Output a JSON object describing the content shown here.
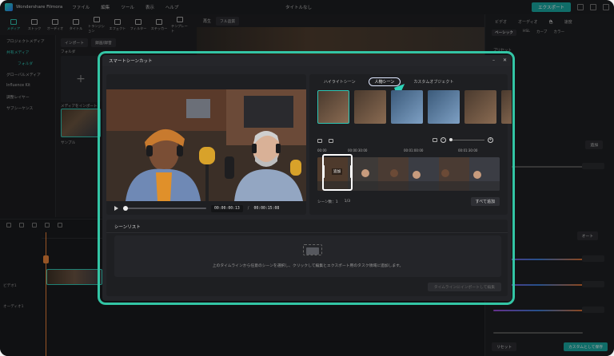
{
  "app": {
    "name": "Wondershare Filmora",
    "doc_title": "タイトルなし",
    "menu": [
      "ファイル",
      "編集",
      "ツール",
      "表示",
      "ヘルプ"
    ],
    "export_label": "エクスポート"
  },
  "toolbar": {
    "tools": [
      "メディア",
      "ストック",
      "オーディオ",
      "タイトル",
      "トランジション",
      "エフェクト",
      "フィルター",
      "ステッカー",
      "テンプレート"
    ]
  },
  "sidebar": {
    "items": [
      "プロジェクトメディア",
      "共有メディア",
      "フォルダ",
      "グローバルメディア",
      "Influence Kit",
      "調整レイヤー",
      "サブシーケンス"
    ]
  },
  "media": {
    "import_label": "インポート",
    "filter_label": "録画/録音",
    "folder_label": "フォルダ",
    "import_tile_label": "メディアをインポート",
    "sample_label": "サンプル"
  },
  "preview": {
    "quality_label": "再生",
    "quality_value": "フル品質"
  },
  "inspector": {
    "tabs": [
      "ビデオ",
      "オーディオ",
      "色",
      "速度"
    ],
    "subtabs": [
      "ベーシック",
      "HSL",
      "カーブ",
      "カラー"
    ],
    "preset_label": "プリセット",
    "add_label": "追加",
    "auto_label": "オート",
    "reset_label": "リセット",
    "save_custom_label": "カスタムとして保存"
  },
  "timeline": {
    "track_video": "ビデオ1",
    "track_audio": "オーディオ1"
  },
  "dialog": {
    "title": "スマートシーンカット",
    "time_current": "00:00:00:13",
    "time_sep": "/",
    "time_total": "00:00:15:08",
    "tabs": [
      "ハイライトシーン",
      "人物シーン",
      "カスタムオブジェクト"
    ],
    "ruler": [
      "00:00",
      "00:00:30:00",
      "00:01:00:00",
      "00:01:30:00"
    ],
    "selected_scene_label": "追加",
    "scene_count_label": "シーン数：1",
    "page_label": "1/3",
    "add_all_label": "すべて追加",
    "scene_list_title": "シーンリスト",
    "empty_text": "上のタイムラインから任意のシーンを選択し、クリックして編集とエクスポート用のタスク領域に追加します。",
    "add_to_timeline_label": "タイムラインにインポートして編集"
  }
}
